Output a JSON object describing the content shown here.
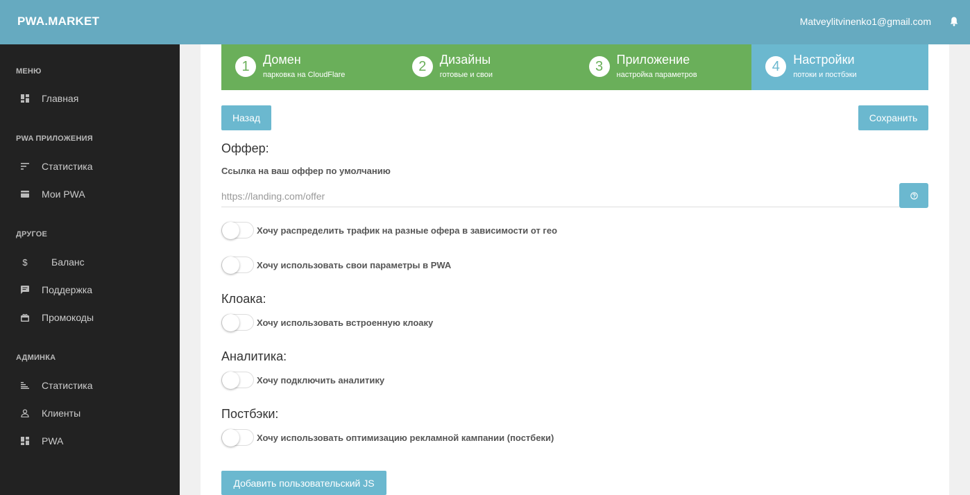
{
  "header": {
    "brand": "PWA.MARKET",
    "user_email": "Matveylitvinenko1@gmail.com"
  },
  "sidebar": {
    "sections": [
      {
        "title": "Меню",
        "items": [
          {
            "label": "Главная",
            "icon": "dashboard-icon"
          }
        ]
      },
      {
        "title": "PWA Приложения",
        "items": [
          {
            "label": "Статистика",
            "icon": "sort-icon"
          },
          {
            "label": "Мои PWA",
            "icon": "card-icon"
          }
        ]
      },
      {
        "title": "Другое",
        "items": [
          {
            "label": "Баланс",
            "icon": "dollar-icon"
          },
          {
            "label": "Поддержка",
            "icon": "chat-icon"
          },
          {
            "label": "Промокоды",
            "icon": "gift-icon"
          }
        ]
      },
      {
        "title": "Админка",
        "items": [
          {
            "label": "Статистика",
            "icon": "bars-icon"
          },
          {
            "label": "Клиенты",
            "icon": "person-icon"
          },
          {
            "label": "PWA",
            "icon": "dashboard-icon"
          }
        ]
      }
    ]
  },
  "stepper": [
    {
      "num": "1",
      "title": "Домен",
      "subtitle": "парковка на CloudFlare",
      "state": "done"
    },
    {
      "num": "2",
      "title": "Дизайны",
      "subtitle": "готовые и свои",
      "state": "done"
    },
    {
      "num": "3",
      "title": "Приложение",
      "subtitle": "настройка параметров",
      "state": "done"
    },
    {
      "num": "4",
      "title": "Настройки",
      "subtitle": "потоки и постбэки",
      "state": "active"
    }
  ],
  "actions": {
    "back_label": "Назад",
    "save_label": "Сохранить"
  },
  "offer": {
    "title": "Оффер:",
    "link_label": "Ссылка на ваш оффер по умолчанию",
    "placeholder": "https://landing.com/offer",
    "toggle_geo": "Хочу распределить трафик на разные офера в зависимости от гео",
    "toggle_params": "Хочу использовать свои параметры в PWA"
  },
  "cloaka": {
    "title": "Клоака:",
    "toggle": "Хочу использовать встроенную клоаку"
  },
  "analytics": {
    "title": "Аналитика:",
    "toggle": "Хочу подключить аналитику"
  },
  "postbacks": {
    "title": "Постбэки:",
    "toggle": "Хочу использовать оптимизацию рекламной кампании (постбеки)"
  },
  "custom_js_label": "Добавить пользовательский JS",
  "colors": {
    "header": "#66aac0",
    "sidebar": "#222222",
    "step_done": "#6aaf5a",
    "step_active": "#6bb8cf",
    "button": "#6bb8cf"
  }
}
